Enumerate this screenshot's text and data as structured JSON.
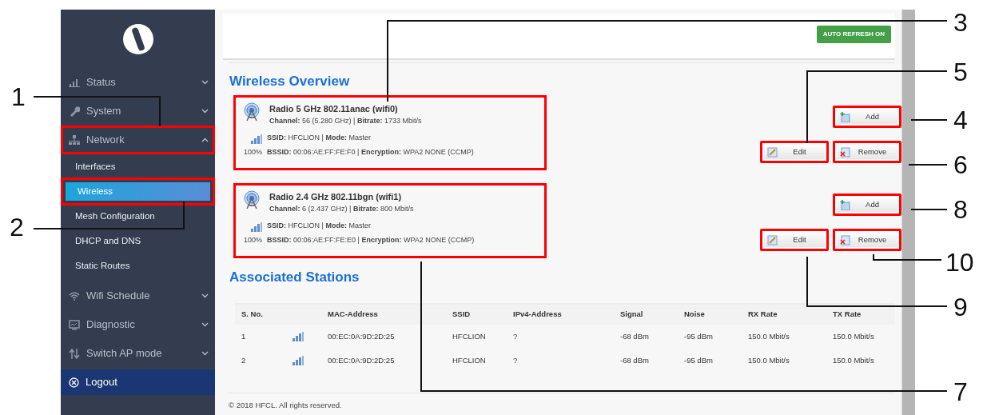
{
  "sidebar": {
    "items": [
      {
        "label": "Status",
        "expanded": false,
        "highlighted": false
      },
      {
        "label": "System",
        "expanded": false,
        "highlighted": false
      },
      {
        "label": "Network",
        "expanded": true,
        "highlighted": true,
        "children": [
          {
            "label": "Interfaces",
            "selected": false,
            "highlighted": false
          },
          {
            "label": "Wireless",
            "selected": true,
            "highlighted": true
          },
          {
            "label": "Mesh Configuration",
            "selected": false,
            "highlighted": false
          },
          {
            "label": "DHCP and DNS",
            "selected": false,
            "highlighted": false
          },
          {
            "label": "Static Routes",
            "selected": false,
            "highlighted": false
          }
        ]
      },
      {
        "label": "Wifi Schedule",
        "expanded": false,
        "highlighted": false
      },
      {
        "label": "Diagnostic",
        "expanded": false,
        "highlighted": false
      },
      {
        "label": "Switch AP mode",
        "expanded": false,
        "highlighted": false
      }
    ],
    "logout": {
      "label": "Logout"
    }
  },
  "header": {
    "auto_refresh": {
      "label": "AUTO REFRESH ON",
      "on": true
    }
  },
  "wireless": {
    "title": "Wireless Overview",
    "radios": [
      {
        "name": "Radio 5 GHz 802.11anac (wifi0)",
        "details": "**Channel:** 56 (5.280 GHz) | **Bitrate:** 1733 Mbit/s",
        "signal": "100%",
        "network": "**SSID:** HFCLION | **Mode:** Master",
        "bssid": "**BSSID:** 00:06:AE:FF:FE:F0 | **Encryption:** WPA2 NONE (CCMP)",
        "highlighted": true,
        "add_button": {
          "label": "Add",
          "highlighted": true
        },
        "edit_button": {
          "label": "Edit",
          "highlighted": true
        },
        "remove_button": {
          "label": "Remove",
          "highlighted": true
        }
      },
      {
        "name": "Radio 2.4 GHz 802.11bgn (wifi1)",
        "details": "**Channel:** 6 (2.437 GHz) | **Bitrate:** 800 Mbit/s",
        "signal": "100%",
        "network": "**SSID:** HFCLION | **Mode:** Master",
        "bssid": "**BSSID:** 00:06:AE:FF:FE:E0 | **Encryption:** WPA2 NONE (CCMP)",
        "highlighted": true,
        "add_button": {
          "label": "Add",
          "highlighted": true
        },
        "edit_button": {
          "label": "Edit",
          "highlighted": true
        },
        "remove_button": {
          "label": "Remove",
          "highlighted": true
        }
      }
    ]
  },
  "stations": {
    "title": "Associated Stations",
    "columns": [
      "S. No.",
      "MAC-Address",
      "SSID",
      "IPv4-Address",
      "Signal",
      "Noise",
      "RX Rate",
      "TX Rate"
    ],
    "rows": [
      [
        "1",
        "00:EC:0A:9D:2D:25",
        "HFCLION",
        "?",
        "-68 dBm",
        "-95 dBm",
        "150.0 Mbit/s",
        "150.0 Mbit/s"
      ],
      [
        "2",
        "00:EC:0A:9D:2D:25",
        "HFCLION",
        "?",
        "-68 dBm",
        "-95 dBm",
        "150.0 Mbit/s",
        "150.0 Mbit/s"
      ]
    ]
  },
  "footer": "© 2018 HFCL. All rights reserved.",
  "callouts": [
    {
      "label": "3"
    },
    {
      "label": "5"
    },
    {
      "label": "1"
    },
    {
      "label": "4"
    },
    {
      "label": "6"
    },
    {
      "label": "8"
    },
    {
      "label": "2"
    },
    {
      "label": "10"
    },
    {
      "label": "9"
    },
    {
      "label": "7"
    }
  ]
}
